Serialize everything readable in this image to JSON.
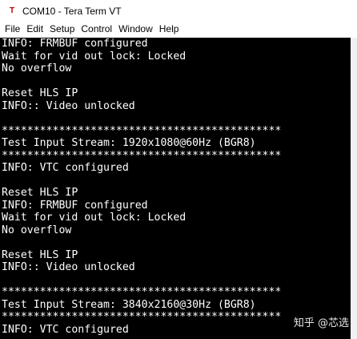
{
  "window": {
    "title": "COM10 - Tera Term VT",
    "icon": "tera-term-icon",
    "icon_glyph": "T"
  },
  "menu": [
    {
      "label": "File"
    },
    {
      "label": "Edit"
    },
    {
      "label": "Setup"
    },
    {
      "label": "Control"
    },
    {
      "label": "Window"
    },
    {
      "label": "Help"
    }
  ],
  "terminal": {
    "colors": {
      "background": "#000000",
      "text": "#ffffff"
    },
    "lines": [
      "INFO: FRMBUF configured",
      "Wait for vid out lock: Locked",
      "No overflow",
      "",
      "Reset HLS IP",
      "INFO:: Video unlocked",
      "",
      "********************************************",
      "Test Input Stream: 1920x1080@60Hz (BGR8)",
      "********************************************",
      "INFO: VTC configured",
      "",
      "Reset HLS IP",
      "INFO: FRMBUF configured",
      "Wait for vid out lock: Locked",
      "No overflow",
      "",
      "Reset HLS IP",
      "INFO:: Video unlocked",
      "",
      "********************************************",
      "Test Input Stream: 3840x2160@30Hz (BGR8)",
      "********************************************",
      "INFO: VTC configured"
    ]
  },
  "watermark": "知乎 @芯选"
}
